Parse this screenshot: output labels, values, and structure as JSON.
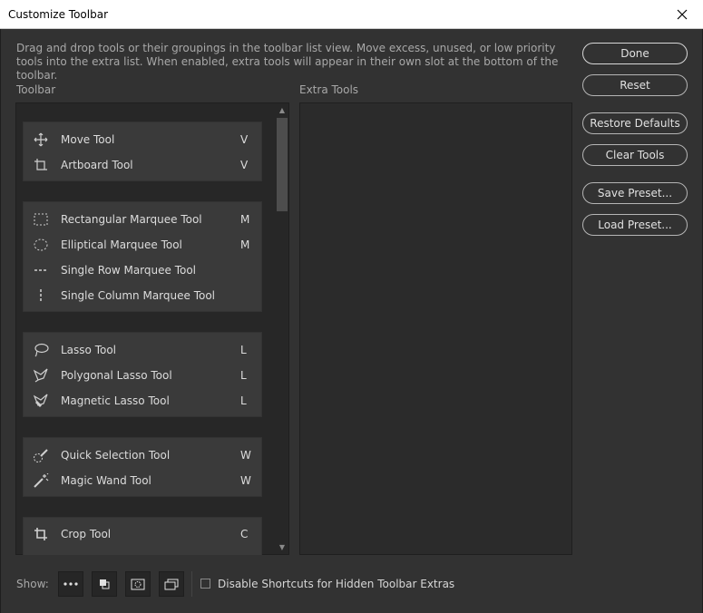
{
  "window": {
    "title": "Customize Toolbar",
    "close_glyph": "✕"
  },
  "description": "Drag and drop tools or their groupings in the toolbar list view. Move excess, unused, or low priority tools into the extra list. When enabled, extra tools will appear in their own slot at the bottom of the toolbar.",
  "labels": {
    "toolbar": "Toolbar",
    "extra_tools": "Extra Tools"
  },
  "groups": [
    {
      "tools": [
        {
          "name": "Move Tool",
          "key": "V",
          "icon": "move-icon"
        },
        {
          "name": "Artboard Tool",
          "key": "V",
          "icon": "artboard-icon"
        }
      ]
    },
    {
      "tools": [
        {
          "name": "Rectangular Marquee Tool",
          "key": "M",
          "icon": "rect-marquee-icon"
        },
        {
          "name": "Elliptical Marquee Tool",
          "key": "M",
          "icon": "ellipse-marquee-icon"
        },
        {
          "name": "Single Row Marquee Tool",
          "key": "",
          "icon": "row-marquee-icon"
        },
        {
          "name": "Single Column Marquee Tool",
          "key": "",
          "icon": "column-marquee-icon"
        }
      ]
    },
    {
      "tools": [
        {
          "name": "Lasso Tool",
          "key": "L",
          "icon": "lasso-icon"
        },
        {
          "name": "Polygonal Lasso Tool",
          "key": "L",
          "icon": "polygonal-lasso-icon"
        },
        {
          "name": "Magnetic Lasso Tool",
          "key": "L",
          "icon": "magnetic-lasso-icon"
        }
      ]
    },
    {
      "tools": [
        {
          "name": "Quick Selection Tool",
          "key": "W",
          "icon": "quick-selection-icon"
        },
        {
          "name": "Magic Wand Tool",
          "key": "W",
          "icon": "magic-wand-icon"
        }
      ]
    },
    {
      "tools": [
        {
          "name": "Crop Tool",
          "key": "C",
          "icon": "crop-icon"
        }
      ]
    }
  ],
  "buttons": {
    "done": "Done",
    "reset": "Reset",
    "restore_defaults": "Restore Defaults",
    "clear_tools": "Clear Tools",
    "save_preset": "Save Preset...",
    "load_preset": "Load Preset..."
  },
  "footer": {
    "show_label": "Show:",
    "show_buttons": [
      "more-icon",
      "foreground-background-icon",
      "quick-mask-icon",
      "screen-mode-icon"
    ],
    "checkbox_label": "Disable Shortcuts for Hidden Toolbar Extras",
    "checkbox_checked": false
  }
}
